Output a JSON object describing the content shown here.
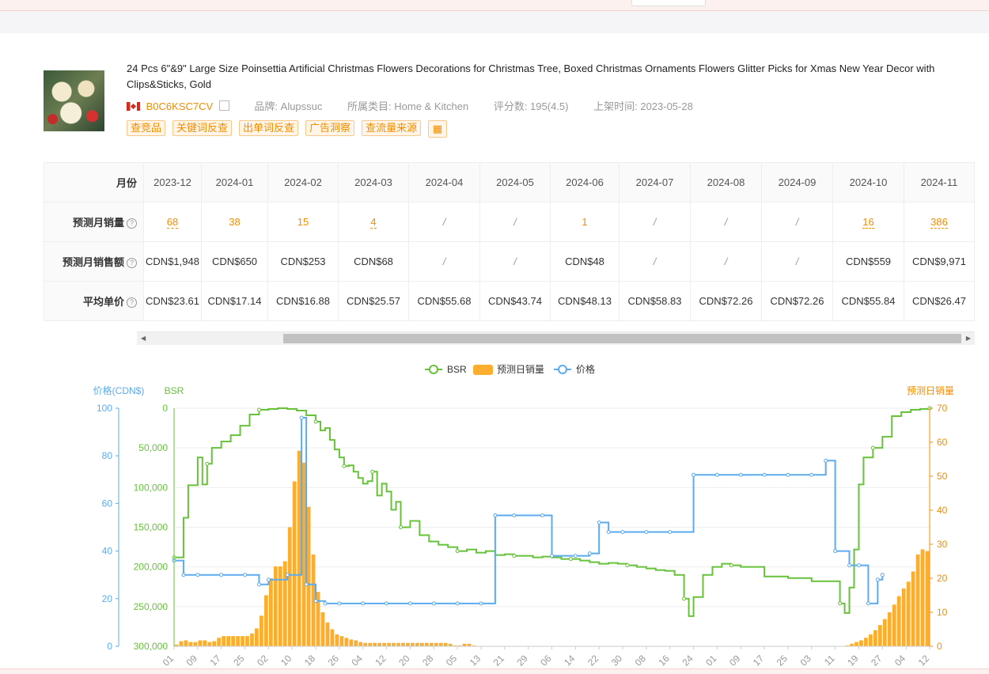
{
  "product": {
    "title": "24 Pcs 6\"&9\" Large Size Poinsettia Artificial Christmas Flowers Decorations for Christmas Tree, Boxed Christmas Ornaments Flowers Glitter Picks for Xmas New Year Decor with Clips&Sticks, Gold",
    "asin": "B0C6KSC7CV",
    "brand": "品牌: Alupssuc",
    "category": "所属类目: Home & Kitchen",
    "rating": "评分数: 195(4.5)",
    "launch": "上架时间: 2023-05-28"
  },
  "tags": [
    "查竞品",
    "关键词反查",
    "出单词反查",
    "广告洞察",
    "查流量来源"
  ],
  "table": {
    "header_label": "月份",
    "months": [
      "2023-12",
      "2024-01",
      "2024-02",
      "2024-03",
      "2024-04",
      "2024-05",
      "2024-06",
      "2024-07",
      "2024-08",
      "2024-09",
      "2024-10",
      "2024-11"
    ],
    "rows": [
      {
        "label": "预测月销量",
        "cells": [
          "68",
          "38",
          "15",
          "4",
          "/",
          "/",
          "1",
          "/",
          "/",
          "/",
          "16",
          "386"
        ]
      },
      {
        "label": "预测月销售额",
        "cells": [
          "CDN$1,948",
          "CDN$650",
          "CDN$253",
          "CDN$68",
          "/",
          "/",
          "CDN$48",
          "/",
          "/",
          "/",
          "CDN$559",
          "CDN$9,971"
        ]
      },
      {
        "label": "平均单价",
        "cells": [
          "CDN$23.61",
          "CDN$17.14",
          "CDN$16.88",
          "CDN$25.57",
          "CDN$55.68",
          "CDN$43.74",
          "CDN$48.13",
          "CDN$58.83",
          "CDN$72.26",
          "CDN$72.26",
          "CDN$55.84",
          "CDN$26.47"
        ]
      }
    ]
  },
  "colors": {
    "bsr": "#67c23a",
    "sales": "#fbad2e",
    "price": "#5aabf0",
    "accent": "#f08c00"
  },
  "chart_data": {
    "type": "line",
    "legend": [
      "BSR",
      "预测日销量",
      "价格"
    ],
    "legend_position": "top-center",
    "axes": {
      "price": {
        "label": "价格(CDN$)",
        "ylim": [
          0,
          100
        ],
        "ticks": [
          "100",
          "80",
          "60",
          "40",
          "20",
          "0"
        ]
      },
      "bsr": {
        "label": "BSR",
        "ylim": [
          0,
          300000
        ],
        "inverted": true,
        "ticks": [
          "0",
          "50,000",
          "100,000",
          "150,000",
          "200,000",
          "250,000",
          "300,000"
        ]
      },
      "sales": {
        "label": "预测日销量",
        "ylim": [
          0,
          70
        ],
        "ticks": [
          "70",
          "60",
          "50",
          "40",
          "30",
          "20",
          "10",
          "0"
        ]
      }
    },
    "x_ticks": [
      "01",
      "09",
      "17",
      "25",
      "02",
      "10",
      "18",
      "26",
      "04",
      "12",
      "20",
      "28",
      "05",
      "13",
      "21",
      "29",
      "06",
      "14",
      "22",
      "30",
      "08",
      "16",
      "24",
      "01",
      "09",
      "17",
      "25",
      "03",
      "11",
      "19",
      "27",
      "04",
      "12"
    ],
    "series": [
      {
        "name": "BSR",
        "points": [
          [
            0,
            188000
          ],
          [
            2,
            138000
          ],
          [
            3,
            97000
          ],
          [
            4,
            97000
          ],
          [
            5,
            62000
          ],
          [
            6,
            96000
          ],
          [
            7,
            70000
          ],
          [
            8,
            50000
          ],
          [
            10,
            42000
          ],
          [
            12,
            34000
          ],
          [
            14,
            22000
          ],
          [
            16,
            8000
          ],
          [
            18,
            2000
          ],
          [
            20,
            1000
          ],
          [
            22,
            0
          ],
          [
            24,
            1000
          ],
          [
            26,
            3000
          ],
          [
            28,
            9000
          ],
          [
            30,
            17000
          ],
          [
            31,
            28000
          ],
          [
            32,
            25000
          ],
          [
            33,
            40000
          ],
          [
            34,
            52000
          ],
          [
            35,
            62000
          ],
          [
            36,
            73000
          ],
          [
            37,
            72000
          ],
          [
            38,
            80000
          ],
          [
            39,
            88000
          ],
          [
            40,
            95000
          ],
          [
            41,
            92000
          ],
          [
            42,
            80000
          ],
          [
            43,
            110000
          ],
          [
            44,
            95000
          ],
          [
            45,
            105000
          ],
          [
            46,
            128000
          ],
          [
            47,
            118000
          ],
          [
            48,
            150000
          ],
          [
            50,
            142000
          ],
          [
            52,
            160000
          ],
          [
            54,
            168000
          ],
          [
            56,
            172000
          ],
          [
            58,
            175000
          ],
          [
            60,
            180000
          ],
          [
            62,
            178000
          ],
          [
            64,
            182000
          ],
          [
            66,
            180000
          ],
          [
            68,
            185000
          ],
          [
            70,
            184000
          ],
          [
            72,
            186000
          ],
          [
            74,
            186000
          ],
          [
            76,
            188000
          ],
          [
            78,
            187000
          ],
          [
            80,
            188000
          ],
          [
            82,
            190000
          ],
          [
            84,
            190000
          ],
          [
            86,
            192000
          ],
          [
            88,
            194000
          ],
          [
            90,
            196000
          ],
          [
            92,
            195000
          ],
          [
            94,
            196000
          ],
          [
            96,
            198000
          ],
          [
            98,
            200000
          ],
          [
            100,
            202000
          ],
          [
            102,
            204000
          ],
          [
            104,
            205000
          ],
          [
            106,
            210000
          ],
          [
            108,
            240000
          ],
          [
            109,
            262000
          ],
          [
            110,
            238000
          ],
          [
            112,
            210000
          ],
          [
            114,
            200000
          ],
          [
            116,
            196000
          ],
          [
            118,
            198000
          ],
          [
            120,
            200000
          ],
          [
            125,
            212000
          ],
          [
            130,
            214000
          ],
          [
            135,
            218000
          ],
          [
            140,
            218000
          ],
          [
            141,
            246000
          ],
          [
            142,
            258000
          ],
          [
            143,
            226000
          ],
          [
            144,
            178000
          ],
          [
            145,
            96000
          ],
          [
            146,
            62000
          ],
          [
            148,
            50000
          ],
          [
            150,
            36000
          ],
          [
            152,
            10000
          ],
          [
            154,
            5000
          ],
          [
            156,
            2000
          ],
          [
            158,
            1000
          ],
          [
            160,
            0
          ]
        ]
      },
      {
        "name": "预测日销量",
        "points": [
          [
            0,
            0
          ],
          [
            2,
            2
          ],
          [
            4,
            1
          ],
          [
            6,
            2
          ],
          [
            8,
            1
          ],
          [
            10,
            3
          ],
          [
            12,
            3
          ],
          [
            14,
            3
          ],
          [
            16,
            3
          ],
          [
            18,
            6
          ],
          [
            19,
            12
          ],
          [
            20,
            18
          ],
          [
            21,
            22
          ],
          [
            22,
            25
          ],
          [
            23,
            22
          ],
          [
            24,
            28
          ],
          [
            25,
            42
          ],
          [
            26,
            55
          ],
          [
            27,
            60
          ],
          [
            28,
            48
          ],
          [
            29,
            34
          ],
          [
            30,
            20
          ],
          [
            31,
            12
          ],
          [
            32,
            8
          ],
          [
            33,
            6
          ],
          [
            34,
            4
          ],
          [
            35,
            3
          ],
          [
            36,
            3
          ],
          [
            37,
            2
          ],
          [
            38,
            2
          ],
          [
            40,
            1
          ],
          [
            42,
            1
          ],
          [
            44,
            1
          ],
          [
            46,
            1
          ],
          [
            48,
            1
          ],
          [
            50,
            1
          ],
          [
            52,
            1
          ],
          [
            54,
            1
          ],
          [
            56,
            1
          ],
          [
            58,
            1
          ],
          [
            60,
            0
          ],
          [
            62,
            1
          ],
          [
            64,
            0
          ],
          [
            66,
            0
          ],
          [
            68,
            0
          ],
          [
            70,
            0
          ],
          [
            72,
            0
          ],
          [
            74,
            0
          ],
          [
            76,
            0
          ],
          [
            78,
            0
          ],
          [
            80,
            0
          ],
          [
            82,
            0
          ],
          [
            84,
            0
          ],
          [
            86,
            0
          ],
          [
            88,
            0
          ],
          [
            90,
            0
          ],
          [
            92,
            0
          ],
          [
            94,
            0
          ],
          [
            96,
            0
          ],
          [
            98,
            0
          ],
          [
            100,
            0
          ],
          [
            102,
            0
          ],
          [
            104,
            0
          ],
          [
            106,
            0
          ],
          [
            108,
            0
          ],
          [
            110,
            0
          ],
          [
            112,
            0
          ],
          [
            114,
            0
          ],
          [
            116,
            0
          ],
          [
            118,
            0
          ],
          [
            120,
            0
          ],
          [
            122,
            0
          ],
          [
            124,
            0
          ],
          [
            126,
            0
          ],
          [
            128,
            0
          ],
          [
            130,
            0
          ],
          [
            132,
            0
          ],
          [
            134,
            0
          ],
          [
            136,
            0
          ],
          [
            138,
            0
          ],
          [
            140,
            0
          ],
          [
            142,
            0
          ],
          [
            144,
            1
          ],
          [
            146,
            2
          ],
          [
            148,
            4
          ],
          [
            150,
            7
          ],
          [
            152,
            11
          ],
          [
            154,
            16
          ],
          [
            156,
            20
          ],
          [
            157,
            24
          ],
          [
            158,
            30
          ],
          [
            159,
            27
          ],
          [
            160,
            29
          ]
        ]
      },
      {
        "name": "价格",
        "points": [
          [
            0,
            36
          ],
          [
            2,
            30
          ],
          [
            5,
            30
          ],
          [
            10,
            30
          ],
          [
            15,
            30
          ],
          [
            18,
            26
          ],
          [
            20,
            28
          ],
          [
            24,
            30
          ],
          [
            27,
            96
          ],
          [
            28,
            26
          ],
          [
            30,
            19
          ],
          [
            32,
            18
          ],
          [
            35,
            18
          ],
          [
            40,
            18
          ],
          [
            45,
            18
          ],
          [
            50,
            18
          ],
          [
            55,
            18
          ],
          [
            60,
            18
          ],
          [
            65,
            18
          ],
          [
            68,
            55
          ],
          [
            72,
            55
          ],
          [
            78,
            55
          ],
          [
            80,
            38
          ],
          [
            85,
            38
          ],
          [
            88,
            39
          ],
          [
            90,
            52
          ],
          [
            92,
            48
          ],
          [
            95,
            48
          ],
          [
            100,
            48
          ],
          [
            105,
            48
          ],
          [
            110,
            72
          ],
          [
            115,
            72
          ],
          [
            120,
            72
          ],
          [
            125,
            72
          ],
          [
            130,
            72
          ],
          [
            135,
            72
          ],
          [
            138,
            78
          ],
          [
            140,
            40
          ],
          [
            143,
            34
          ],
          [
            145,
            34
          ],
          [
            147,
            18
          ],
          [
            149,
            28
          ],
          [
            150,
            30
          ]
        ]
      }
    ]
  }
}
